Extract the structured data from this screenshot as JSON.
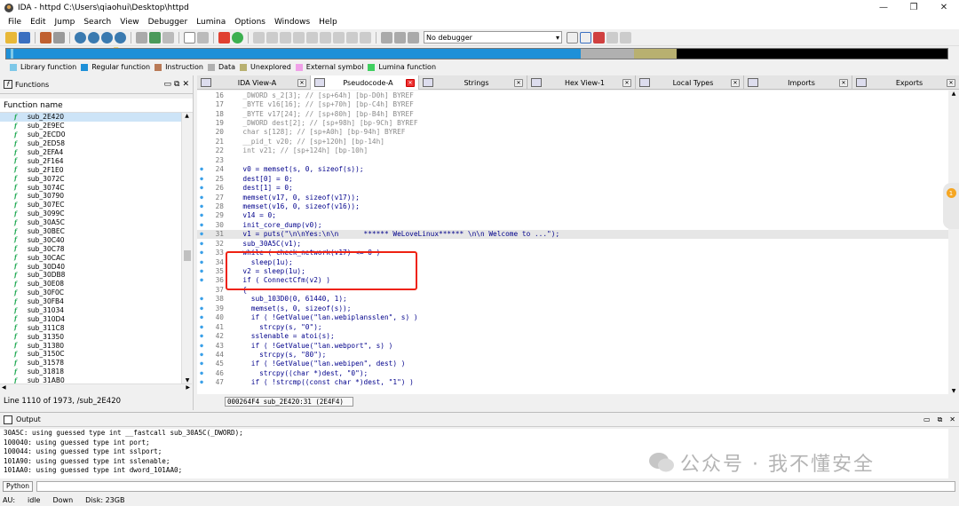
{
  "window": {
    "title": "IDA - httpd C:\\Users\\qiaohui\\Desktop\\httpd",
    "min": "—",
    "max": "❐",
    "close": "✕"
  },
  "menu": [
    "File",
    "Edit",
    "Jump",
    "Search",
    "View",
    "Debugger",
    "Lumina",
    "Options",
    "Windows",
    "Help"
  ],
  "toolbar": {
    "debugger_select": "No debugger"
  },
  "legend": [
    {
      "label": "Library function",
      "color": "#7ec8e8"
    },
    {
      "label": "Regular function",
      "color": "#1e90d8"
    },
    {
      "label": "Instruction",
      "color": "#b97a57"
    },
    {
      "label": "Data",
      "color": "#b0b0b0"
    },
    {
      "label": "Unexplored",
      "color": "#b8b070"
    },
    {
      "label": "External symbol",
      "color": "#f0a0e8"
    },
    {
      "label": "Lumina function",
      "color": "#40d060"
    }
  ],
  "functions": {
    "panel_title": "Functions",
    "column": "Function name",
    "items": [
      "sub_2E420",
      "sub_2E9EC",
      "sub_2ECD0",
      "sub_2ED58",
      "sub_2EFA4",
      "sub_2F164",
      "sub_2F1E0",
      "sub_3072C",
      "sub_3074C",
      "sub_30790",
      "sub_307EC",
      "sub_3099C",
      "sub_30A5C",
      "sub_30BEC",
      "sub_30C40",
      "sub_30C78",
      "sub_30CAC",
      "sub_30D40",
      "sub_30DB8",
      "sub_30E08",
      "sub_30F0C",
      "sub_30FB4",
      "sub_31034",
      "sub_310D4",
      "sub_311C8",
      "sub_31350",
      "sub_31380",
      "sub_3150C",
      "sub_31578",
      "sub_31818",
      "sub_31AB0"
    ],
    "selected_index": 0,
    "status": "Line 1110 of 1973, /sub_2E420"
  },
  "tabs": [
    {
      "label": "IDA View-A",
      "active": false
    },
    {
      "label": "Pseudocode-A",
      "active": true
    },
    {
      "label": "Strings",
      "active": false
    },
    {
      "label": "Hex View-1",
      "active": false
    },
    {
      "label": "Local Types",
      "active": false
    },
    {
      "label": "Imports",
      "active": false
    },
    {
      "label": "Exports",
      "active": false
    }
  ],
  "code": [
    {
      "n": "16",
      "dot": false,
      "t": "  _DWORD s_2[3]; // [sp+64h] [bp-D0h] BYREF"
    },
    {
      "n": "17",
      "dot": false,
      "t": "  _BYTE v16[16]; // [sp+70h] [bp-C4h] BYREF"
    },
    {
      "n": "18",
      "dot": false,
      "t": "  _BYTE v17[24]; // [sp+80h] [bp-B4h] BYREF"
    },
    {
      "n": "19",
      "dot": false,
      "t": "  _DWORD dest[2]; // [sp+98h] [bp-9Ch] BYREF"
    },
    {
      "n": "20",
      "dot": false,
      "t": "  char s[128]; // [sp+A0h] [bp-94h] BYREF"
    },
    {
      "n": "21",
      "dot": false,
      "t": "  __pid_t v20; // [sp+120h] [bp-14h]"
    },
    {
      "n": "22",
      "dot": false,
      "t": "  int v21; // [sp+124h] [bp-10h]"
    },
    {
      "n": "23",
      "dot": false,
      "t": ""
    },
    {
      "n": "24",
      "dot": true,
      "t": "  v0 = memset(s, 0, sizeof(s));"
    },
    {
      "n": "25",
      "dot": true,
      "t": "  dest[0] = 0;"
    },
    {
      "n": "26",
      "dot": true,
      "t": "  dest[1] = 0;"
    },
    {
      "n": "27",
      "dot": true,
      "t": "  memset(v17, 0, sizeof(v17));"
    },
    {
      "n": "28",
      "dot": true,
      "t": "  memset(v16, 0, sizeof(v16));"
    },
    {
      "n": "29",
      "dot": true,
      "t": "  v14 = 0;"
    },
    {
      "n": "30",
      "dot": true,
      "t": "  init_core_dump(v0);"
    },
    {
      "n": "31",
      "dot": true,
      "t": "  v1 = puts(\"\\n\\nYes:\\n\\n      ****** WeLoveLinux****** \\n\\n Welcome to ...\");",
      "hl": true
    },
    {
      "n": "32",
      "dot": true,
      "t": "  sub_30A5C(v1);"
    },
    {
      "n": "33",
      "dot": true,
      "t": "  while ( check_network(v17) <= 0 )"
    },
    {
      "n": "34",
      "dot": true,
      "t": "    sleep(1u);"
    },
    {
      "n": "35",
      "dot": true,
      "t": "  v2 = sleep(1u);"
    },
    {
      "n": "36",
      "dot": true,
      "t": "  if ( ConnectCfm(v2) )"
    },
    {
      "n": "37",
      "dot": false,
      "t": "  {"
    },
    {
      "n": "38",
      "dot": true,
      "t": "    sub_103D0(0, 61440, 1);"
    },
    {
      "n": "39",
      "dot": true,
      "t": "    memset(s, 0, sizeof(s));"
    },
    {
      "n": "40",
      "dot": true,
      "t": "    if ( !GetValue(\"lan.webiplansslen\", s) )"
    },
    {
      "n": "41",
      "dot": true,
      "t": "      strcpy(s, \"0\");"
    },
    {
      "n": "42",
      "dot": true,
      "t": "    sslenable = atoi(s);"
    },
    {
      "n": "43",
      "dot": true,
      "t": "    if ( !GetValue(\"lan.webport\", s) )"
    },
    {
      "n": "44",
      "dot": true,
      "t": "      strcpy(s, \"80\");"
    },
    {
      "n": "45",
      "dot": true,
      "t": "    if ( !GetValue(\"lan.webipen\", dest) )"
    },
    {
      "n": "46",
      "dot": true,
      "t": "      strcpy((char *)dest, \"0\");"
    },
    {
      "n": "47",
      "dot": true,
      "t": "    if ( !strcmp((const char *)dest, \"1\") )"
    }
  ],
  "code_status": "000264F4 sub_2E420:31 (2E4F4)",
  "badge": "1",
  "output": {
    "title": "Output",
    "lines": [
      "30A5C: using guessed type int __fastcall sub_30A5C(_DWORD);",
      "100040: using guessed type int port;",
      "100044: using guessed type int sslport;",
      "101A90: using guessed type int sslenable;",
      "101AA0: using guessed type int dword_101AA0;"
    ],
    "lang_button": "Python"
  },
  "statusbar": {
    "au": "AU:",
    "state": "idle",
    "dir": "Down",
    "disk": "Disk: 23GB"
  },
  "watermark": "公众号 · 我不懂安全"
}
